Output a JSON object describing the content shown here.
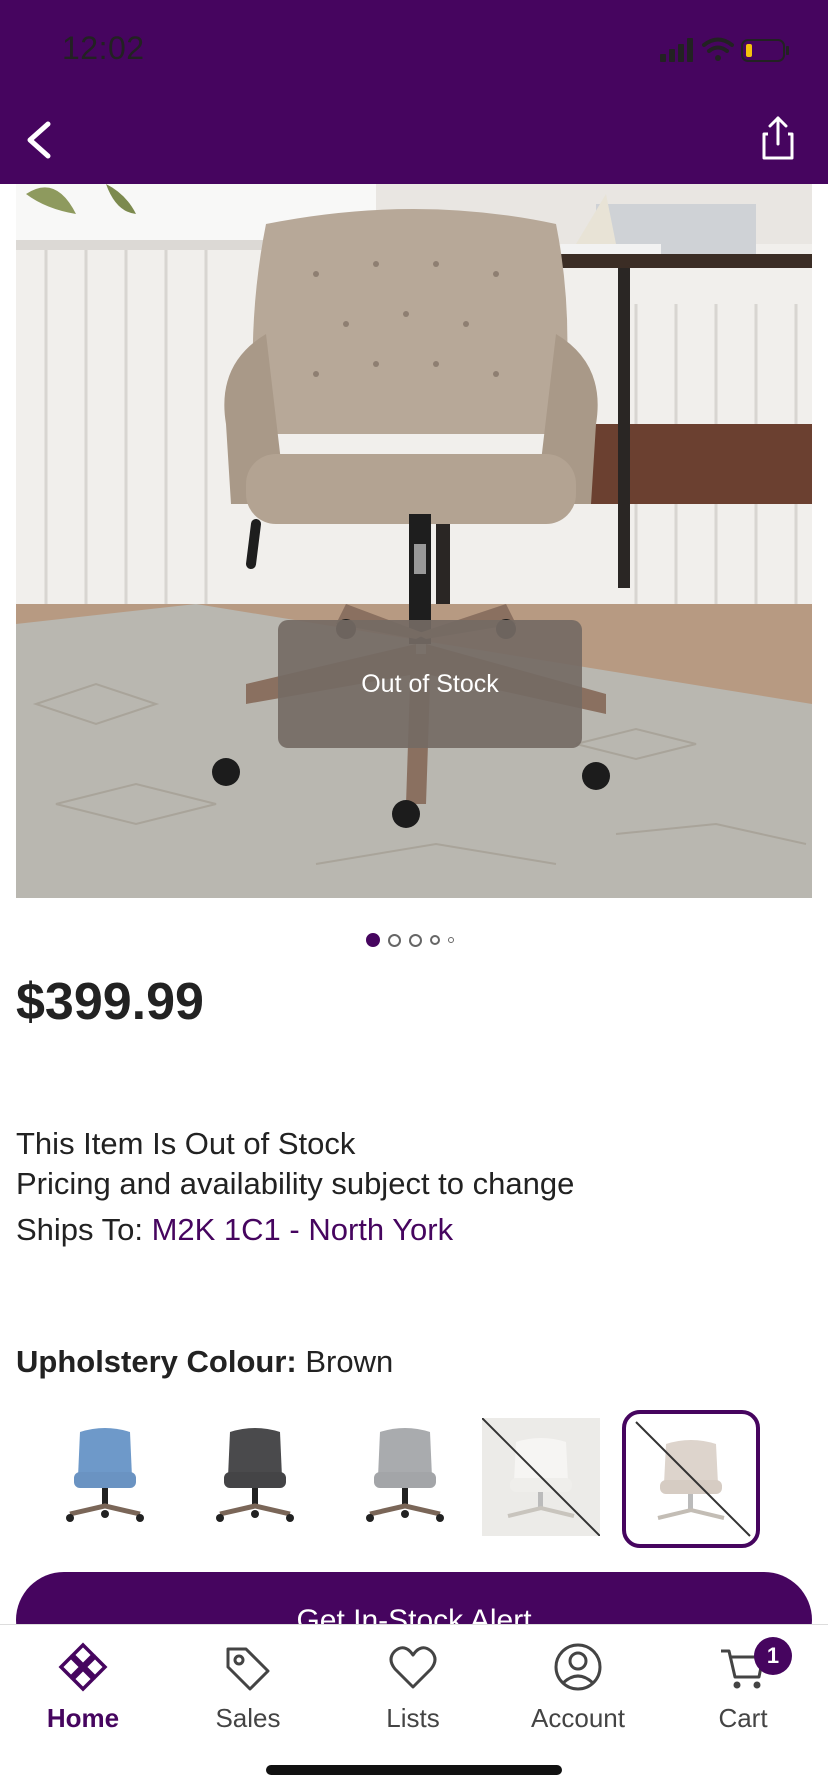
{
  "status_bar": {
    "time": "12:02"
  },
  "product": {
    "price": "$399.99",
    "overlay_label": "Out of Stock",
    "stock_message": "This Item Is Out of Stock",
    "pricing_note": "Pricing and availability subject to change",
    "ships_to_label": "Ships To:",
    "ships_to_location": "M2K 1C1 - North York",
    "image_count": 5,
    "current_image": 1
  },
  "options": {
    "colour_label": "Upholstery Colour:",
    "colour_value": "Brown",
    "swatches": [
      {
        "name": "blue",
        "available": true
      },
      {
        "name": "dark-grey",
        "available": true
      },
      {
        "name": "light-grey",
        "available": true
      },
      {
        "name": "white",
        "available": false
      },
      {
        "name": "brown",
        "available": false,
        "selected": true
      }
    ]
  },
  "cta": {
    "alert_label": "Get In-Stock Alert"
  },
  "tabbar": {
    "items": [
      {
        "label": "Home",
        "icon": "home-icon",
        "active": true
      },
      {
        "label": "Sales",
        "icon": "tag-icon"
      },
      {
        "label": "Lists",
        "icon": "heart-icon"
      },
      {
        "label": "Account",
        "icon": "account-icon"
      },
      {
        "label": "Cart",
        "icon": "cart-icon"
      }
    ],
    "cart_count": "1"
  },
  "colors": {
    "brand": "#46055f",
    "overlay": "#746a64"
  }
}
